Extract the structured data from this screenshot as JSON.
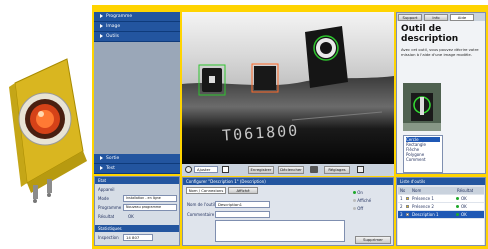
{
  "app": {
    "accent": "#ffd400",
    "menu_blue": "#23559f"
  },
  "left_menu": {
    "items_top": [
      "Programme",
      "Image",
      "Outils"
    ],
    "items_bottom": [
      "Sortie",
      "Test"
    ]
  },
  "info_panel": {
    "title": "Etat",
    "rows": [
      {
        "label": "Appareil",
        "value": ""
      },
      {
        "label": "Mode",
        "value": "Installation - en ligne"
      },
      {
        "label": "Programme",
        "value": "Nouveau programme"
      },
      {
        "label": "Résultat",
        "value": "OK"
      }
    ],
    "stats_title": "Statistiques",
    "stats_label": "Inspection",
    "stats_value": "14 807"
  },
  "toolbar": {
    "zoom_label": "Ajuster",
    "btn1": "Enregistrer",
    "btn2": "Déclencher",
    "btn3": "Réglages"
  },
  "image_overlay": {
    "serial_text": "T061800"
  },
  "config_panel": {
    "title": "Configurer \"Description 1\" (Description)",
    "tabs": [
      "Nom / Connexions",
      "Affiché"
    ],
    "fields": [
      {
        "label": "Nom de l'outil",
        "value": "Description1"
      },
      {
        "label": "Commentaire",
        "value": ""
      }
    ],
    "mode_options": [
      "On",
      "Affiché",
      "Off"
    ],
    "apply_button": "Supprimer"
  },
  "help_panel": {
    "tabs": [
      "Support",
      "Info",
      "Aide"
    ],
    "title": "Outil de description",
    "body": "Avec cet outil, vous pouvez décrire votre mission à l'aide d'une image modèle.",
    "options": [
      "Cercle",
      "Rectangle",
      "Flèche",
      "Polygone",
      "Comment"
    ]
  },
  "tools_list": {
    "title": "Liste d'outils",
    "columns": [
      "No",
      "Nom",
      "Résultat"
    ],
    "rows": [
      {
        "no": "1",
        "name": "Présence 1",
        "result": "OK"
      },
      {
        "no": "2",
        "name": "Présence 2",
        "result": "OK"
      },
      {
        "no": "3",
        "name": "Description 1",
        "result": "OK"
      }
    ]
  }
}
